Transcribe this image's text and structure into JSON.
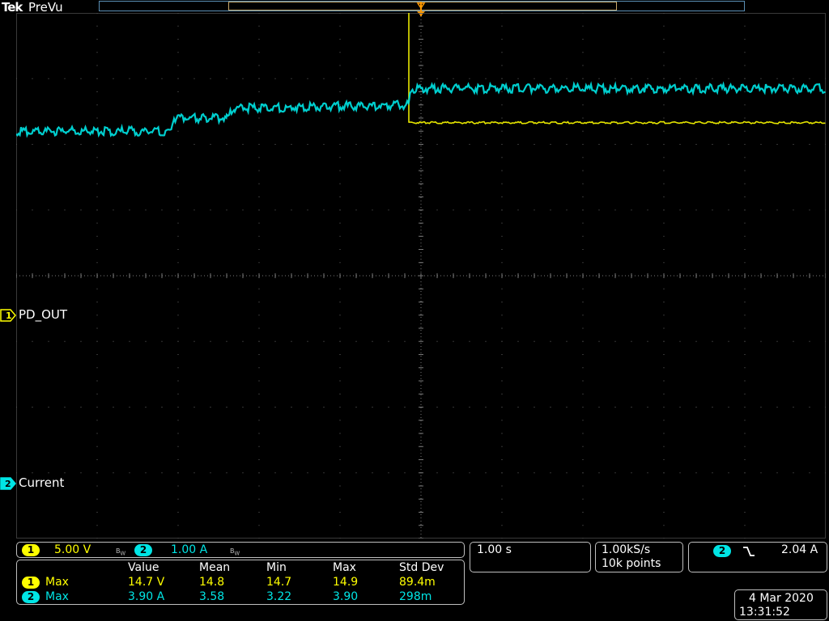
{
  "header": {
    "brand": "Tek",
    "mode": "PreVu"
  },
  "channels": {
    "ch1": {
      "number": "1",
      "label": "PD_OUT",
      "color": "#ffff00",
      "scale": "5.00 V",
      "bw_icon": "bandwidth-limit-icon"
    },
    "ch2": {
      "number": "2",
      "label": "Current",
      "color": "#00e5e5",
      "scale": "1.00 A",
      "bw_icon": "bandwidth-limit-icon"
    }
  },
  "timebase": "1.00 s",
  "acquisition": {
    "rate": "1.00kS/s",
    "points": "10k points"
  },
  "trigger": {
    "source": "2",
    "slope_icon": "falling-edge-icon",
    "level": "2.04 A"
  },
  "measurements": {
    "headers": [
      "Value",
      "Mean",
      "Min",
      "Max",
      "Std Dev"
    ],
    "rows": [
      {
        "channel": "1",
        "type": "Max",
        "value": "14.7 V",
        "mean": "14.8",
        "min": "14.7",
        "max": "14.9",
        "std": "89.4m"
      },
      {
        "channel": "2",
        "type": "Max",
        "value": "3.90 A",
        "mean": "3.58",
        "min": "3.22",
        "max": "3.90",
        "std": "298m"
      }
    ]
  },
  "datetime": {
    "date": "4 Mar 2020",
    "time": "13:31:52"
  },
  "chart_data": {
    "type": "line",
    "xlabel": "",
    "ylabel": "",
    "x_units": "s",
    "x_div": 1.0,
    "x_range": [
      -5,
      5
    ],
    "series": [
      {
        "name": "PD_OUT",
        "color": "#ffff00",
        "units": "V",
        "volts_per_div": 5.0,
        "offset_divs": 2.25,
        "points": [
          [
            -5.0,
            14.7
          ],
          [
            -0.15,
            14.6
          ],
          [
            -0.15,
            0.4
          ],
          [
            5.0,
            0.4
          ]
        ]
      },
      {
        "name": "Current",
        "color": "#00e5e5",
        "units": "A",
        "amps_per_div": 1.0,
        "offset_divs": -1.0,
        "points": [
          [
            -5.0,
            3.2
          ],
          [
            -3.1,
            3.2
          ],
          [
            -3.05,
            3.4
          ],
          [
            -2.4,
            3.4
          ],
          [
            -2.3,
            3.55
          ],
          [
            -0.15,
            3.6
          ],
          [
            -0.12,
            3.85
          ],
          [
            5.0,
            3.85
          ]
        ]
      }
    ]
  }
}
